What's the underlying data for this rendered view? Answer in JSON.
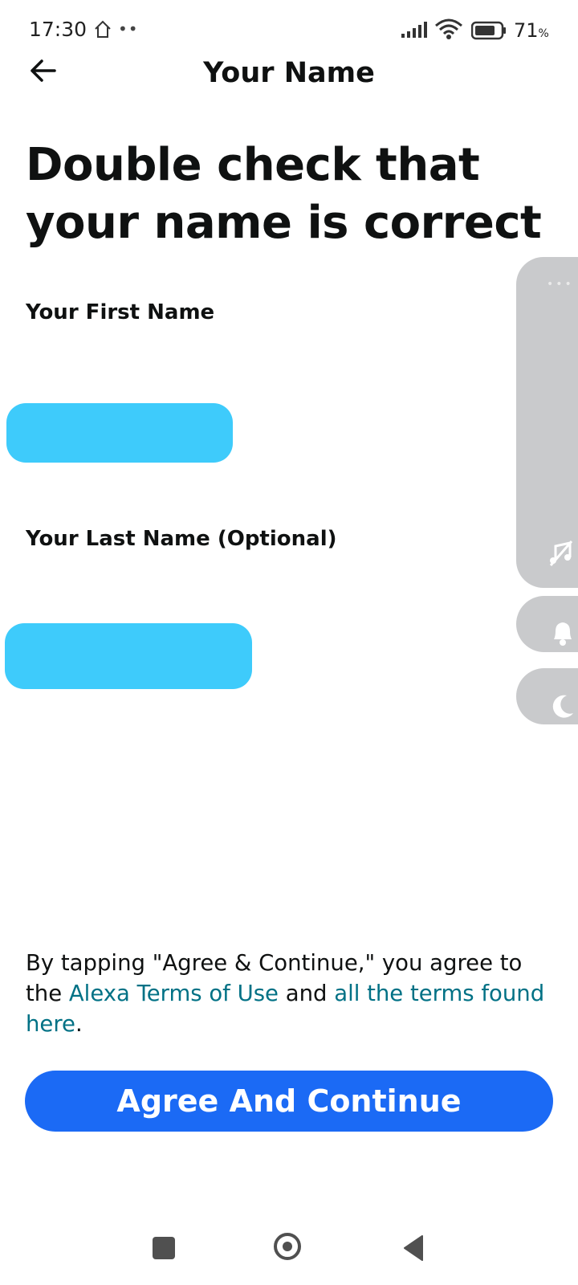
{
  "status_bar": {
    "time": "17:30",
    "battery_level": "71",
    "battery_unit": "%",
    "icons": [
      "home-icon",
      "more-dots-icon",
      "signal-icon",
      "wifi-icon",
      "battery-icon"
    ]
  },
  "header": {
    "title": "Your Name",
    "back_icon": "back-arrow-icon"
  },
  "headline": {
    "line1": "Double check that",
    "line2": "your name is correct"
  },
  "form": {
    "first_name_label": "Your First Name",
    "first_name_value": "",
    "last_name_label": "Your Last Name (Optional)",
    "last_name_value": ""
  },
  "side_panel": {
    "dots": "•••",
    "icons": [
      "music-off-icon",
      "bell-icon",
      "moon-icon"
    ]
  },
  "legal": {
    "prefix": "By tapping \"Agree & Continue,\" you agree to the ",
    "link1": "Alexa Terms of Use",
    "middle": " and ",
    "link2": "all the terms found here",
    "suffix": "."
  },
  "actions": {
    "agree_label": "Agree And Continue"
  },
  "nav_bar": {
    "icons": [
      "recent-apps-icon",
      "home-circle-icon",
      "back-triangle-icon"
    ]
  },
  "colors": {
    "primary_button": "#1b6af5",
    "link": "#007185",
    "redaction": "#3ecbfb",
    "overlay_panel": "#c9cacc"
  }
}
